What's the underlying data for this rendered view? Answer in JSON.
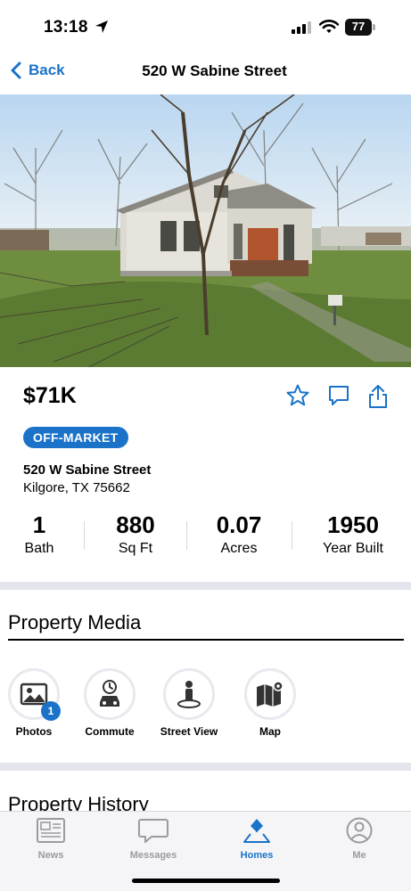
{
  "status_bar": {
    "time": "13:18",
    "battery": "77"
  },
  "nav": {
    "back_label": "Back",
    "title": "520 W Sabine Street"
  },
  "listing": {
    "price": "$71K",
    "status_badge": "OFF-MARKET",
    "address_line1": "520 W Sabine Street",
    "address_line2": "Kilgore, TX 75662"
  },
  "stats": [
    {
      "value": "1",
      "label": "Bath"
    },
    {
      "value": "880",
      "label": "Sq Ft"
    },
    {
      "value": "0.07",
      "label": "Acres"
    },
    {
      "value": "1950",
      "label": "Year Built"
    }
  ],
  "media": {
    "title": "Property Media",
    "items": [
      {
        "label": "Photos",
        "icon": "photo-icon",
        "count": "1"
      },
      {
        "label": "Commute",
        "icon": "commute-car-icon"
      },
      {
        "label": "Street View",
        "icon": "street-view-person-icon"
      },
      {
        "label": "Map",
        "icon": "map-pin-icon"
      }
    ]
  },
  "history": {
    "title": "Property History"
  },
  "tabs": [
    {
      "label": "News",
      "icon": "news-icon",
      "active": false
    },
    {
      "label": "Messages",
      "icon": "messages-icon",
      "active": false
    },
    {
      "label": "Homes",
      "icon": "homes-icon",
      "active": true
    },
    {
      "label": "Me",
      "icon": "person-icon",
      "active": false
    }
  ],
  "colors": {
    "accent": "#1a73c8",
    "separator": "#e3e6ec",
    "tab_inactive": "#9a9aa0"
  }
}
